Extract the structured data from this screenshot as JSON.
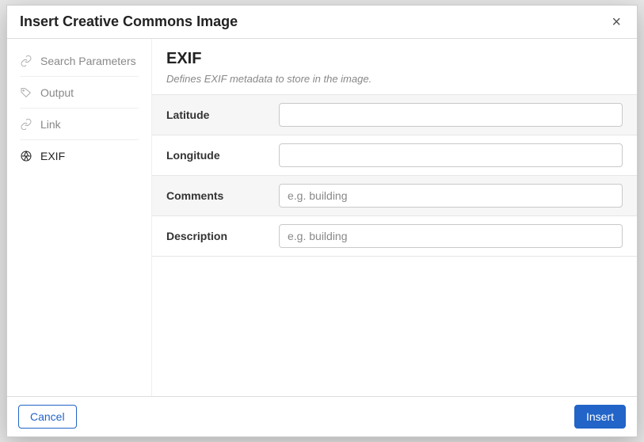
{
  "dialog": {
    "title": "Insert Creative Commons Image",
    "close_label": "×"
  },
  "sidebar": {
    "items": [
      {
        "label": "Search Parameters"
      },
      {
        "label": "Output"
      },
      {
        "label": "Link"
      },
      {
        "label": "EXIF"
      }
    ],
    "active_index": 3
  },
  "main": {
    "title": "EXIF",
    "description": "Defines EXIF metadata to store in the image.",
    "fields": [
      {
        "label": "Latitude",
        "value": "",
        "placeholder": ""
      },
      {
        "label": "Longitude",
        "value": "",
        "placeholder": ""
      },
      {
        "label": "Comments",
        "value": "",
        "placeholder": "e.g. building"
      },
      {
        "label": "Description",
        "value": "",
        "placeholder": "e.g. building"
      }
    ]
  },
  "footer": {
    "cancel_label": "Cancel",
    "insert_label": "Insert"
  }
}
